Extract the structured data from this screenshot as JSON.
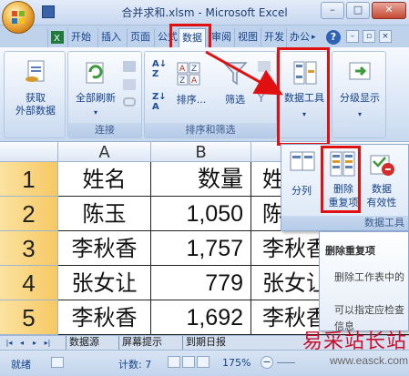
{
  "window": {
    "title": "合并求和.xlsm - Microsoft Excel",
    "minimize": "–",
    "maximize": "□",
    "close": "✕"
  },
  "tabs": [
    "开始",
    "插入",
    "页面",
    "公式",
    "数据",
    "审阅",
    "视图",
    "开发",
    "办公"
  ],
  "tab_scroll": "▸",
  "help": "?",
  "ribbon": {
    "get_external": [
      "获取",
      "外部数据"
    ],
    "refresh_all": "全部刷新",
    "group_connections": "连接",
    "sort": "排序...",
    "filter": "筛选",
    "group_sort_filter": "排序和筛选",
    "data_tools": "数据工具",
    "outline": "分级显示"
  },
  "panel": {
    "text_to_columns": "分列",
    "remove_duplicates": [
      "删除",
      "重复项"
    ],
    "data_validation": [
      "数据",
      "有效性"
    ],
    "group_label": "数据工具"
  },
  "tooltip": {
    "title": "删除重复项",
    "line1": "删除工作表中的",
    "line2": "可以指定应检查",
    "line3": "信息"
  },
  "columns": [
    "A",
    "B",
    "C"
  ],
  "rows": [
    {
      "num": "1",
      "name": "姓名",
      "qty": "数量",
      "extra": "姓"
    },
    {
      "num": "2",
      "name": "陈玉",
      "qty": "1,050",
      "extra": "陈"
    },
    {
      "num": "3",
      "name": "李秋香",
      "qty": "1,757",
      "extra": "李秋香"
    },
    {
      "num": "4",
      "name": "张女让",
      "qty": "779",
      "extra": "张女让"
    },
    {
      "num": "5",
      "name": "李秋香",
      "qty": "1,692",
      "extra": "李秋香"
    }
  ],
  "sheet_tabs": [
    "数据源",
    "屏幕提示",
    "到期日报"
  ],
  "status": {
    "ready": "就绪",
    "count": "计数: 7",
    "zoom": "175%"
  },
  "watermark": {
    "cn": "易采站长站",
    "url": "www.easck.com"
  },
  "colors": {
    "highlight": "#e01010",
    "accent": "#15428b"
  }
}
